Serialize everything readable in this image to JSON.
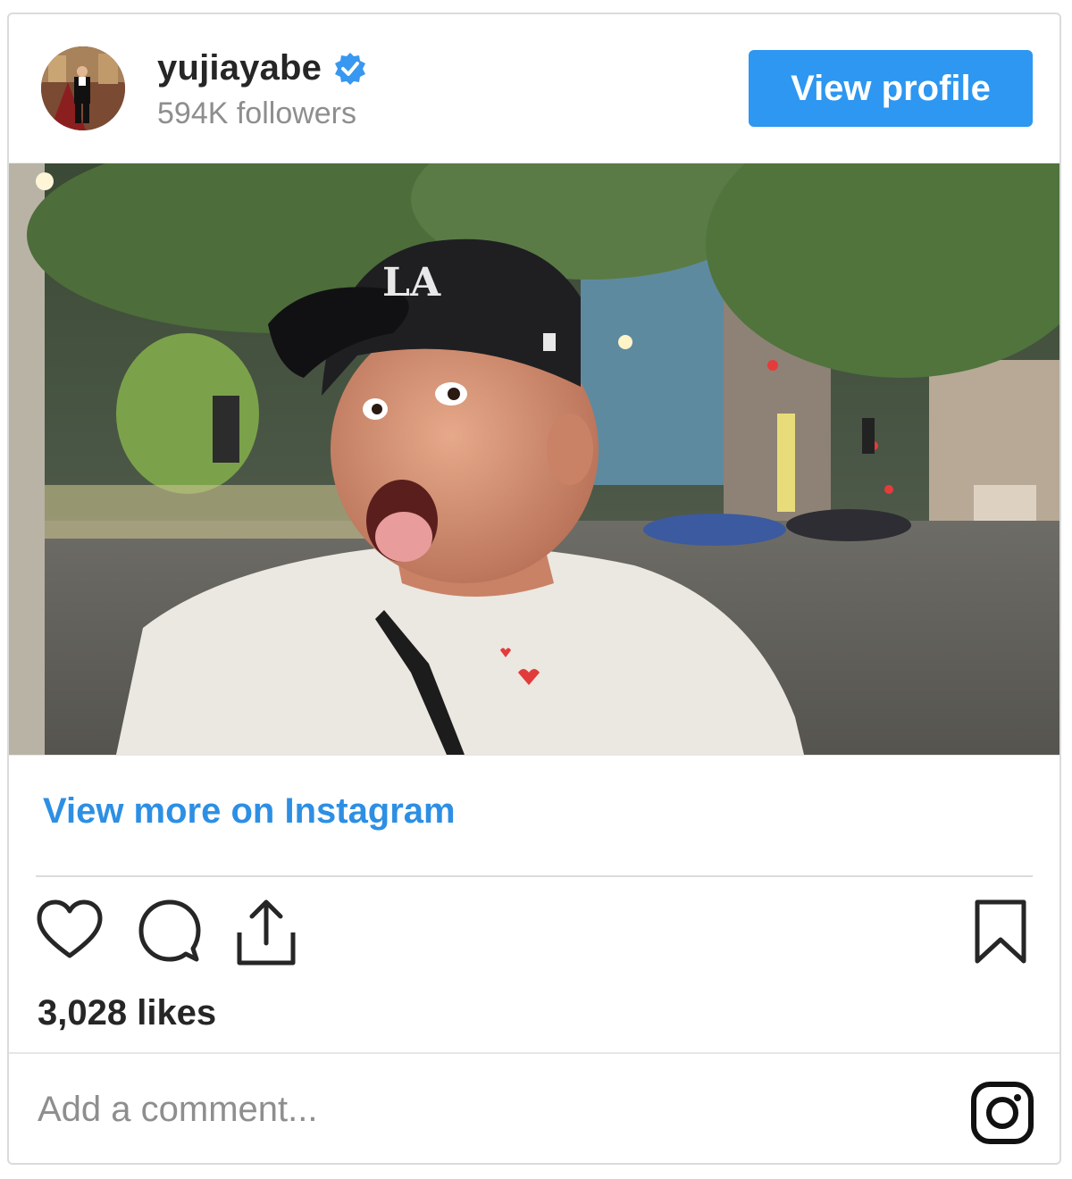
{
  "header": {
    "username": "yujiayabe",
    "followers": "594K followers",
    "view_profile_label": "View profile"
  },
  "post": {
    "view_more_label": "View more on Instagram",
    "likes": "3,028 likes"
  },
  "comment": {
    "placeholder": "Add a comment..."
  },
  "icons": {
    "verified": "verified-badge-icon",
    "like": "heart-icon",
    "comment": "comment-bubble-icon",
    "share": "share-icon",
    "save": "bookmark-icon",
    "instagram": "instagram-logo-icon"
  },
  "colors": {
    "accent": "#2d97f1",
    "link": "#2d8fe4",
    "text": "#262626",
    "muted": "#8e8e8e",
    "border": "#dbdbdb"
  }
}
